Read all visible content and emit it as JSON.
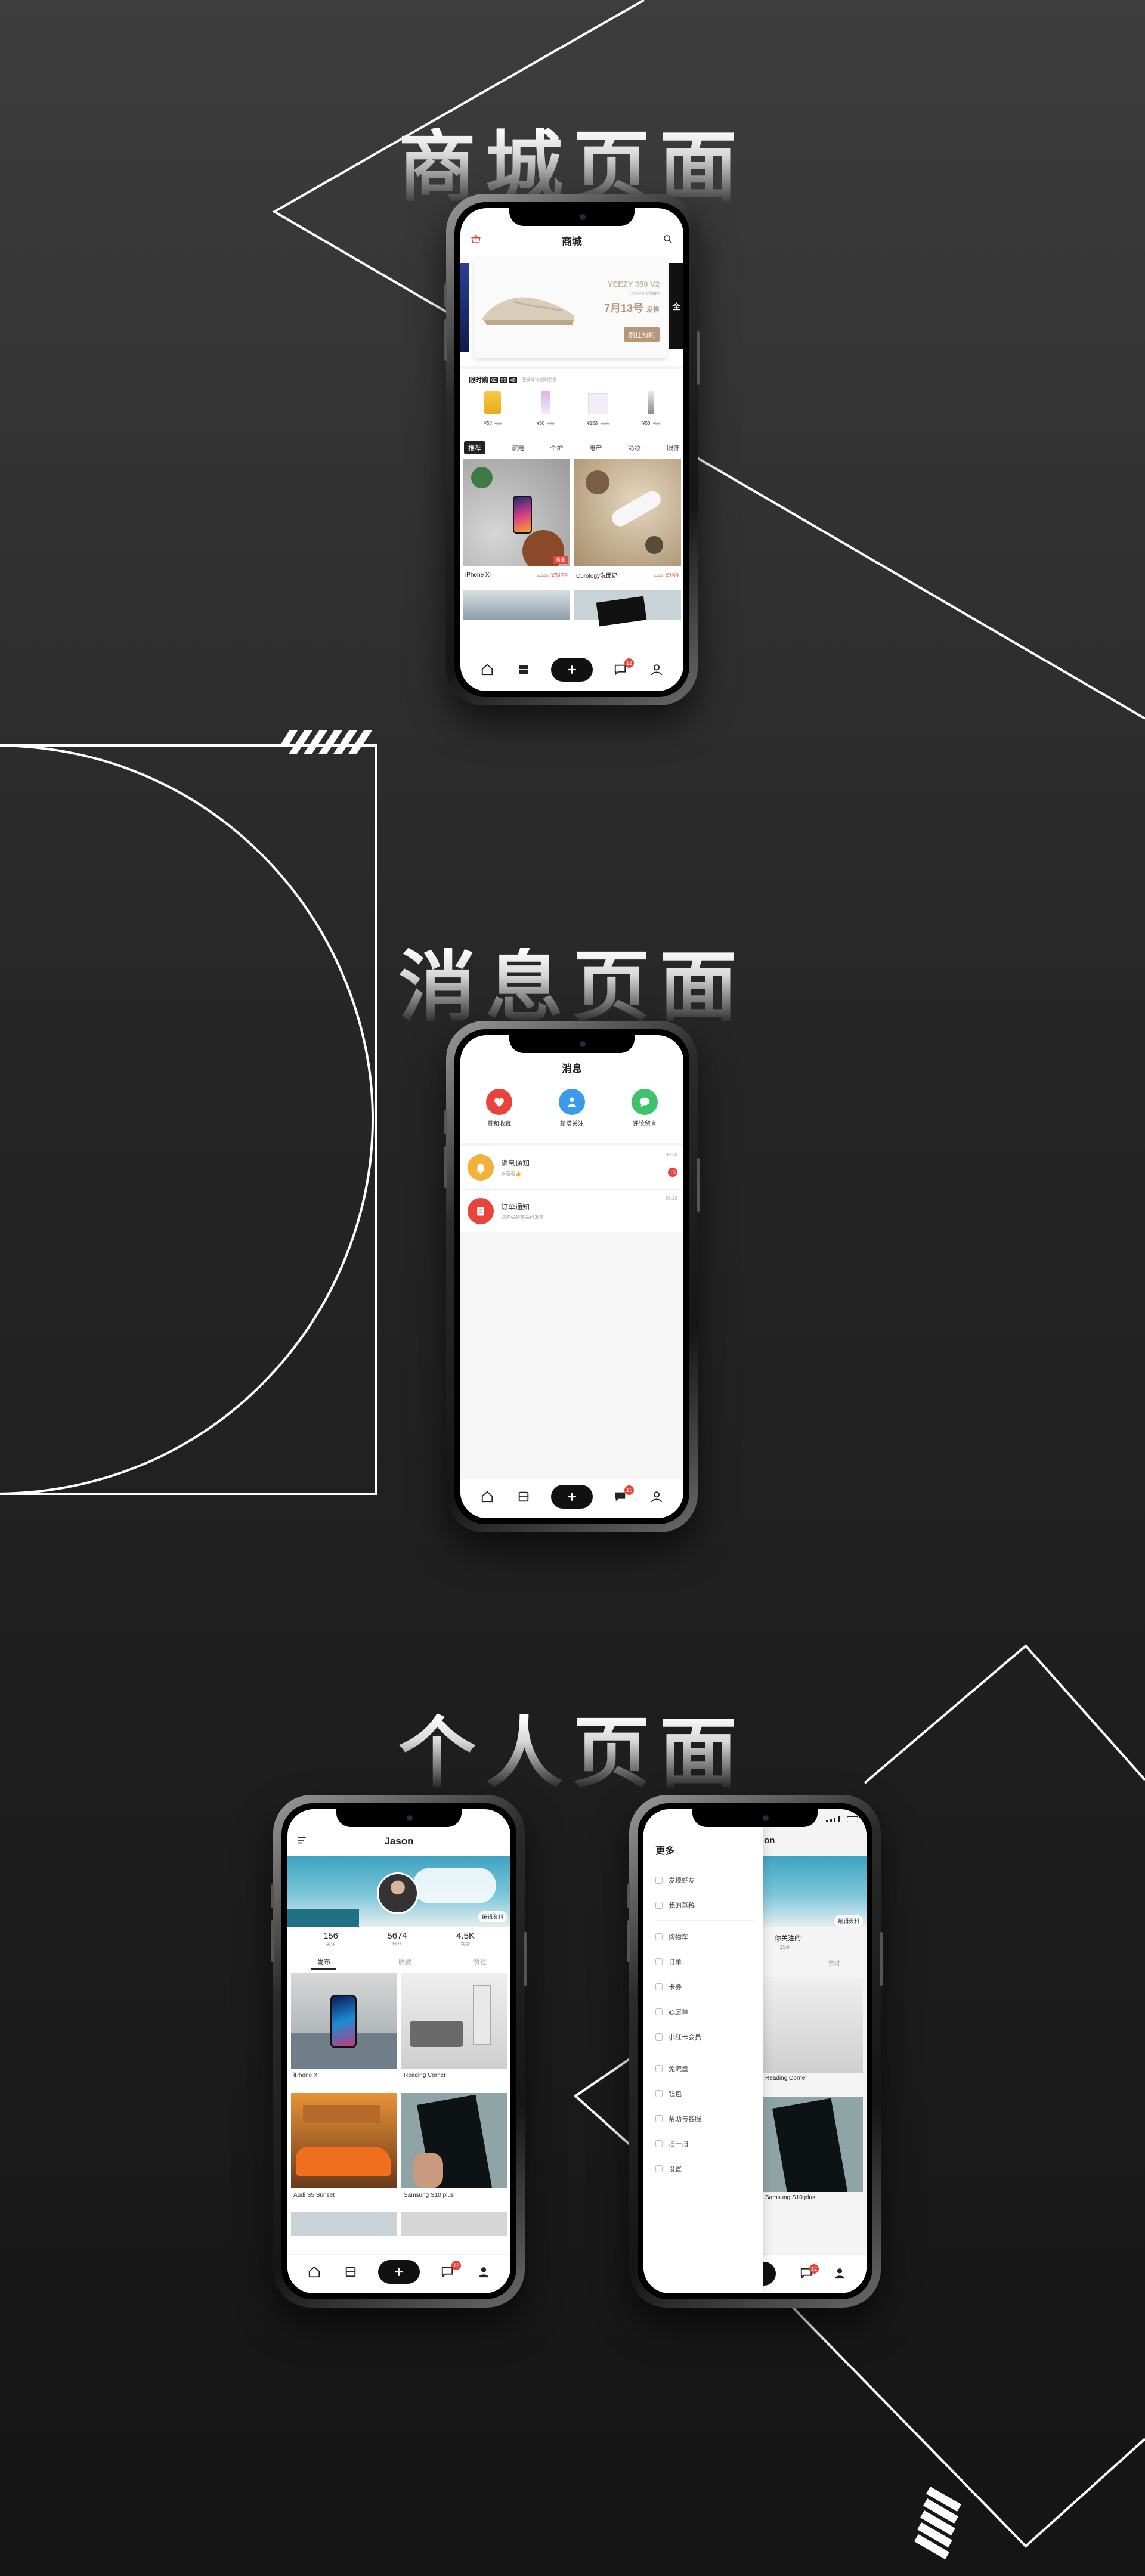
{
  "titles": {
    "shop": "商城页面",
    "message": "消息页面",
    "profile": "个人页面"
  },
  "colors": {
    "accent": "#e8443c",
    "dark": "#111111",
    "promo_button": "#b8967a"
  },
  "shop": {
    "header_title": "商城",
    "banner": {
      "product_name": "YEEZY 350 V2",
      "sub": "Cream/White",
      "date_text": "7月13号",
      "date_suffix": "发售",
      "button": "前往预约",
      "side_label": "全"
    },
    "flash_sale": {
      "label": "限时购",
      "timer": [
        "02",
        "59",
        "48"
      ],
      "more": "更多好物 限时特惠"
    },
    "flash_items": [
      {
        "price": "¥59",
        "old": "¥99"
      },
      {
        "price": "¥30",
        "old": "¥45"
      },
      {
        "price": "¥153",
        "old": "¥199"
      },
      {
        "price": "¥59",
        "old": "¥99"
      }
    ],
    "categories": [
      "推荐",
      "家电",
      "个护",
      "电产",
      "彩妆",
      "服饰"
    ],
    "products": [
      {
        "name": "iPhone Xr",
        "old": "¥5999",
        "price": "¥5199",
        "tag": "新品"
      },
      {
        "name": "Curology洗面奶",
        "old": "¥199",
        "price": "¥169"
      }
    ],
    "nav_badge": "12"
  },
  "message": {
    "header_title": "消息",
    "quick": [
      {
        "label": "赞和收藏",
        "color": "#e8443c",
        "icon": "heart-icon"
      },
      {
        "label": "新增关注",
        "color": "#3a9bec",
        "icon": "person-icon"
      },
      {
        "label": "评论留言",
        "color": "#3ec36b",
        "icon": "chat-icon"
      }
    ],
    "items": [
      {
        "title": "消息通知",
        "sub": "来看看👍",
        "time": "09:30",
        "badge": "15",
        "color": "#f3b13b",
        "icon": "bell-icon"
      },
      {
        "title": "订单通知",
        "sub": "您购买的商品已发货",
        "time": "08:20",
        "color": "#e8443c",
        "icon": "clipboard-icon"
      }
    ],
    "nav_badge": "15"
  },
  "profile": {
    "username": "Jason",
    "edit_button": "编辑资料",
    "stats": [
      {
        "value": "156",
        "label": "关注"
      },
      {
        "value": "5674",
        "label": "粉丝"
      },
      {
        "value": "4.5K",
        "label": "获赞"
      }
    ],
    "tabs": [
      "发布",
      "收藏",
      "赞过"
    ],
    "posts": [
      {
        "caption": "iPhone X"
      },
      {
        "caption": "Reading Corner"
      },
      {
        "caption": "Audi S5 Sunset"
      },
      {
        "caption": "Samsung S10 plus"
      }
    ],
    "nav_badge": "12"
  },
  "drawer": {
    "title": "更多",
    "items": [
      "发现好友",
      "我的草稿",
      "购物车",
      "订单",
      "卡券",
      "心愿单",
      "小红卡会员",
      "免流量",
      "钱包",
      "帮助与客服",
      "扫一扫",
      "设置"
    ],
    "behind": {
      "partial_title": "on",
      "edit_button": "编辑资料",
      "following_label": "你关注的",
      "following_count": "156",
      "tab_label": "赞过",
      "caption1": "Reading Corner",
      "caption2": "Samsung S10 plus"
    }
  }
}
